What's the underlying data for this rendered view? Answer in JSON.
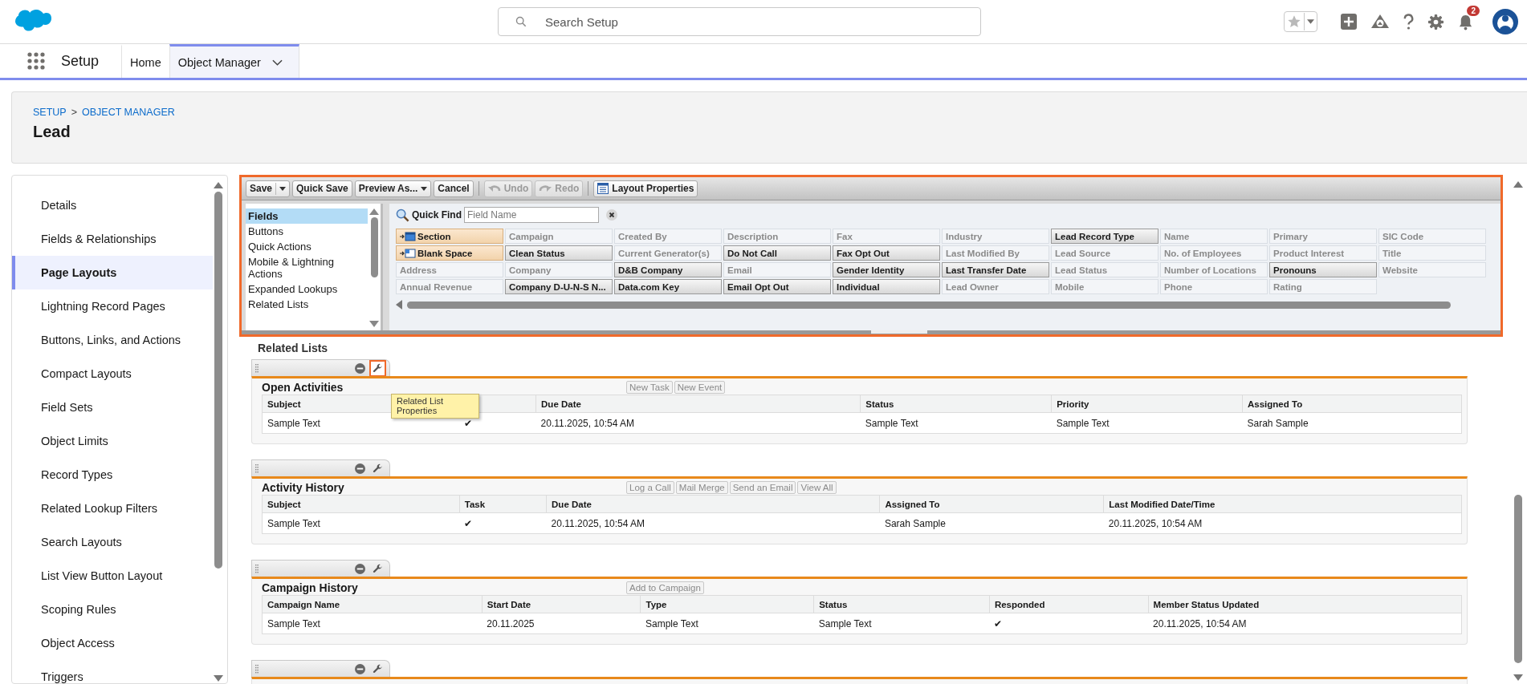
{
  "top_bar": {
    "search": {
      "placeholder": "Search Setup"
    },
    "notification_count": "2"
  },
  "nav": {
    "app_name": "Setup",
    "tabs": [
      {
        "label": "Home",
        "selected": false,
        "has_menu": false
      },
      {
        "label": "Object Manager",
        "selected": true,
        "has_menu": true
      }
    ]
  },
  "page_header": {
    "breadcrumb": [
      {
        "label": "SETUP"
      },
      {
        "label": "OBJECT MANAGER"
      }
    ],
    "separator": ">",
    "title": "Lead"
  },
  "sidebar": {
    "items": [
      {
        "label": "Details",
        "selected": false
      },
      {
        "label": "Fields & Relationships",
        "selected": false
      },
      {
        "label": "Page Layouts",
        "selected": true
      },
      {
        "label": "Lightning Record Pages",
        "selected": false
      },
      {
        "label": "Buttons, Links, and Actions",
        "selected": false
      },
      {
        "label": "Compact Layouts",
        "selected": false
      },
      {
        "label": "Field Sets",
        "selected": false
      },
      {
        "label": "Object Limits",
        "selected": false
      },
      {
        "label": "Record Types",
        "selected": false
      },
      {
        "label": "Related Lookup Filters",
        "selected": false
      },
      {
        "label": "Search Layouts",
        "selected": false
      },
      {
        "label": "List View Button Layout",
        "selected": false
      },
      {
        "label": "Scoping Rules",
        "selected": false
      },
      {
        "label": "Object Access",
        "selected": false
      },
      {
        "label": "Triggers",
        "selected": false
      }
    ]
  },
  "editor": {
    "toolbar": [
      {
        "label": "Save",
        "kind": "split",
        "disabled": false
      },
      {
        "label": "Quick Save",
        "kind": "plain",
        "disabled": false
      },
      {
        "label": "Preview As...",
        "kind": "menu",
        "disabled": false
      },
      {
        "label": "Cancel",
        "kind": "plain",
        "disabled": false
      },
      {
        "label": "Undo",
        "kind": "undo",
        "disabled": true
      },
      {
        "label": "Redo",
        "kind": "redo",
        "disabled": true
      },
      {
        "label": "Layout Properties",
        "kind": "properties",
        "disabled": false
      }
    ],
    "categories": [
      {
        "label": "Fields",
        "selected": true
      },
      {
        "label": "Buttons",
        "selected": false
      },
      {
        "label": "Quick Actions",
        "selected": false
      },
      {
        "label": "Mobile & Lightning Actions",
        "selected": false
      },
      {
        "label": "Expanded Lookups",
        "selected": false
      },
      {
        "label": "Related Lists",
        "selected": false
      }
    ],
    "quick_find": {
      "label": "Quick Find",
      "placeholder": "Field Name"
    },
    "palette": [
      [
        {
          "label": "Section",
          "kind": "section",
          "on_layout": false
        },
        {
          "label": "Campaign",
          "kind": "field",
          "on_layout": true
        },
        {
          "label": "Created By",
          "kind": "field",
          "on_layout": true
        },
        {
          "label": "Description",
          "kind": "field",
          "on_layout": true
        },
        {
          "label": "Fax",
          "kind": "field",
          "on_layout": true
        },
        {
          "label": "Industry",
          "kind": "field",
          "on_layout": true
        },
        {
          "label": "Lead Record Type",
          "kind": "field",
          "on_layout": false
        },
        {
          "label": "Name",
          "kind": "field",
          "on_layout": true
        },
        {
          "label": "Primary",
          "kind": "field",
          "on_layout": true
        },
        {
          "label": "SIC Code",
          "kind": "field",
          "on_layout": true
        }
      ],
      [
        {
          "label": "Blank Space",
          "kind": "blank-space",
          "on_layout": false
        },
        {
          "label": "Clean Status",
          "kind": "field",
          "on_layout": false
        },
        {
          "label": "Current Generator(s)",
          "kind": "field",
          "on_layout": true
        },
        {
          "label": "Do Not Call",
          "kind": "field",
          "on_layout": false
        },
        {
          "label": "Fax Opt Out",
          "kind": "field",
          "on_layout": false
        },
        {
          "label": "Last Modified By",
          "kind": "field",
          "on_layout": true
        },
        {
          "label": "Lead Source",
          "kind": "field",
          "on_layout": true
        },
        {
          "label": "No. of Employees",
          "kind": "field",
          "on_layout": true
        },
        {
          "label": "Product Interest",
          "kind": "field",
          "on_layout": true
        },
        {
          "label": "Title",
          "kind": "field",
          "on_layout": true
        }
      ],
      [
        {
          "label": "Address",
          "kind": "field",
          "on_layout": true
        },
        {
          "label": "Company",
          "kind": "field",
          "on_layout": true
        },
        {
          "label": "D&B Company",
          "kind": "field",
          "on_layout": false
        },
        {
          "label": "Email",
          "kind": "field",
          "on_layout": true
        },
        {
          "label": "Gender Identity",
          "kind": "field",
          "on_layout": false
        },
        {
          "label": "Last Transfer Date",
          "kind": "field",
          "on_layout": false
        },
        {
          "label": "Lead Status",
          "kind": "field",
          "on_layout": true
        },
        {
          "label": "Number of Locations",
          "kind": "field",
          "on_layout": true
        },
        {
          "label": "Pronouns",
          "kind": "field",
          "on_layout": false
        },
        {
          "label": "Website",
          "kind": "field",
          "on_layout": true
        }
      ],
      [
        {
          "label": "Annual Revenue",
          "kind": "field",
          "on_layout": true
        },
        {
          "label": "Company D-U-N-S N...",
          "kind": "field",
          "on_layout": false
        },
        {
          "label": "Data.com Key",
          "kind": "field",
          "on_layout": false
        },
        {
          "label": "Email Opt Out",
          "kind": "field",
          "on_layout": false
        },
        {
          "label": "Individual",
          "kind": "field",
          "on_layout": false
        },
        {
          "label": "Lead Owner",
          "kind": "field",
          "on_layout": true
        },
        {
          "label": "Mobile",
          "kind": "field",
          "on_layout": true
        },
        {
          "label": "Phone",
          "kind": "field",
          "on_layout": true
        },
        {
          "label": "Rating",
          "kind": "field",
          "on_layout": true
        }
      ]
    ]
  },
  "related_lists": {
    "title": "Related Lists",
    "lists": [
      {
        "title": "Open Activities",
        "properties_selected": true,
        "tooltip": "Related List Properties",
        "buttons": [
          "New Task",
          "New Event"
        ],
        "columns": [
          "Subject",
          null,
          "Due Date",
          "Status",
          "Priority",
          "Assigned To"
        ],
        "rows": [
          [
            "Sample Text",
            "✔",
            "20.11.2025, 10:54 AM",
            "Sample Text",
            "Sample Text",
            "Sarah Sample"
          ]
        ]
      },
      {
        "title": "Activity History",
        "properties_selected": false,
        "buttons": [
          "Log a Call",
          "Mail Merge",
          "Send an Email",
          "View All"
        ],
        "columns": [
          "Subject",
          "Task",
          "Due Date",
          "Assigned To",
          "Last Modified Date/Time"
        ],
        "rows": [
          [
            "Sample Text",
            "✔",
            "20.11.2025, 10:54 AM",
            "Sarah Sample",
            "20.11.2025, 10:54 AM"
          ]
        ]
      },
      {
        "title": "Campaign History",
        "properties_selected": false,
        "buttons": [
          "Add to Campaign"
        ],
        "columns": [
          "Campaign Name",
          "Start Date",
          "Type",
          "Status",
          "Responded",
          "Member Status Updated"
        ],
        "rows": [
          [
            "Sample Text",
            "20.11.2025",
            "Sample Text",
            "Sample Text",
            "✔",
            "20.11.2025, 10:54 AM"
          ]
        ]
      }
    ]
  }
}
